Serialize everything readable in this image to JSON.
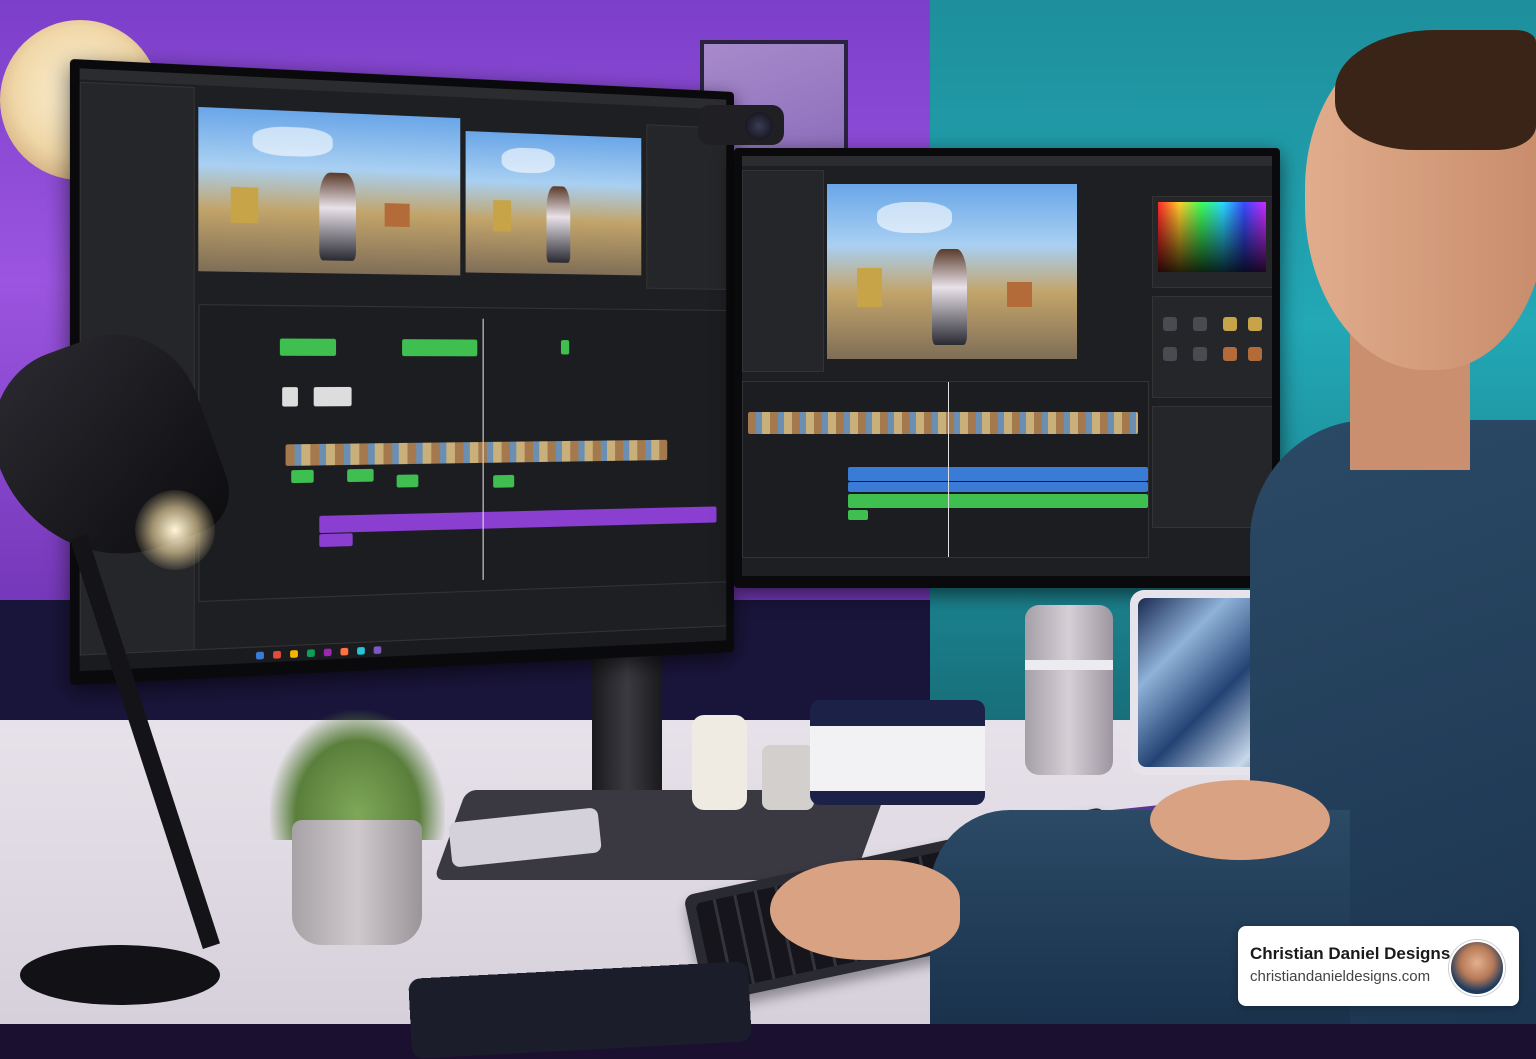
{
  "badge": {
    "name": "Christian Daniel Designs",
    "url": "christiandanieldesigns.com"
  },
  "colors": {
    "wall_purple": "#9b55e0",
    "wall_teal": "#23a8b6",
    "timeline_green": "#3fbf4f",
    "timeline_purple": "#8a3fd1",
    "timeline_blue": "#3a7bd5"
  },
  "icons": [
    "webcam-icon",
    "avatar-photo"
  ]
}
